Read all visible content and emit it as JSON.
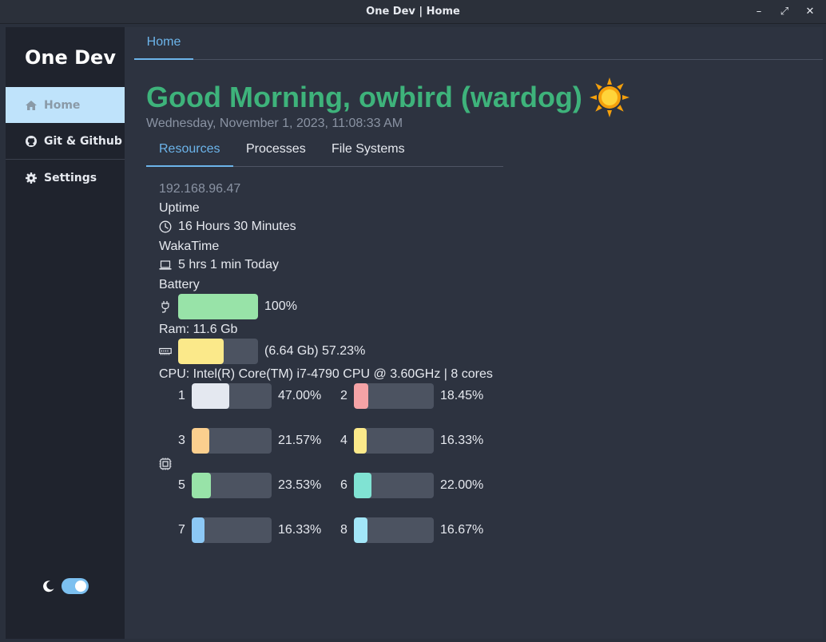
{
  "window": {
    "title": "One Dev | Home",
    "minimize": "–",
    "maximize": "⤢",
    "close": "✕"
  },
  "sidebar": {
    "logo": "One Dev",
    "items": [
      {
        "label": "Home",
        "icon": "home-icon"
      },
      {
        "label": "Git & Github",
        "icon": "github-icon"
      },
      {
        "label": "Settings",
        "icon": "gear-icon"
      }
    ],
    "theme_toggle": {
      "icon": "moon-icon",
      "on": true
    }
  },
  "main": {
    "top_tab": "Home",
    "greeting": "Good Morning, owbird (wardog)",
    "greeting_icon": "sun-icon",
    "datetime": "Wednesday, November 1, 2023, 11:08:33 AM",
    "tabs": [
      "Resources",
      "Processes",
      "File Systems"
    ],
    "active_tab": "Resources"
  },
  "resources": {
    "ip": "192.168.96.47",
    "uptime_label": "Uptime",
    "uptime_value": "16 Hours  30 Minutes",
    "wakatime_label": "WakaTime",
    "wakatime_value": "5 hrs 1 min Today",
    "battery_label": "Battery",
    "battery_percent_text": "100%",
    "battery_level": 100,
    "ram_label": "Ram: 11.6 Gb",
    "ram_text": "(6.64 Gb) 57.23%",
    "ram_level": 57.23,
    "cpu_label": "CPU: Intel(R) Core(TM) i7-4790 CPU @ 3.60GHz | 8 cores",
    "cores": [
      {
        "id": "1",
        "pct_text": "47.00%",
        "level": 47.0,
        "color": "#e4e8f0"
      },
      {
        "id": "2",
        "pct_text": "18.45%",
        "level": 18.45,
        "color": "#f5a3a6"
      },
      {
        "id": "3",
        "pct_text": "21.57%",
        "level": 21.57,
        "color": "#fbcf8e"
      },
      {
        "id": "4",
        "pct_text": "16.33%",
        "level": 16.33,
        "color": "#fbe98a"
      },
      {
        "id": "5",
        "pct_text": "23.53%",
        "level": 23.53,
        "color": "#98e3a8"
      },
      {
        "id": "6",
        "pct_text": "22.00%",
        "level": 22.0,
        "color": "#80e3d3"
      },
      {
        "id": "7",
        "pct_text": "16.33%",
        "level": 16.33,
        "color": "#8cc8f5"
      },
      {
        "id": "8",
        "pct_text": "16.67%",
        "level": 16.67,
        "color": "#a2e6f8"
      }
    ],
    "colors": {
      "battery": "#98e3a8",
      "ram": "#fbe98a"
    }
  }
}
